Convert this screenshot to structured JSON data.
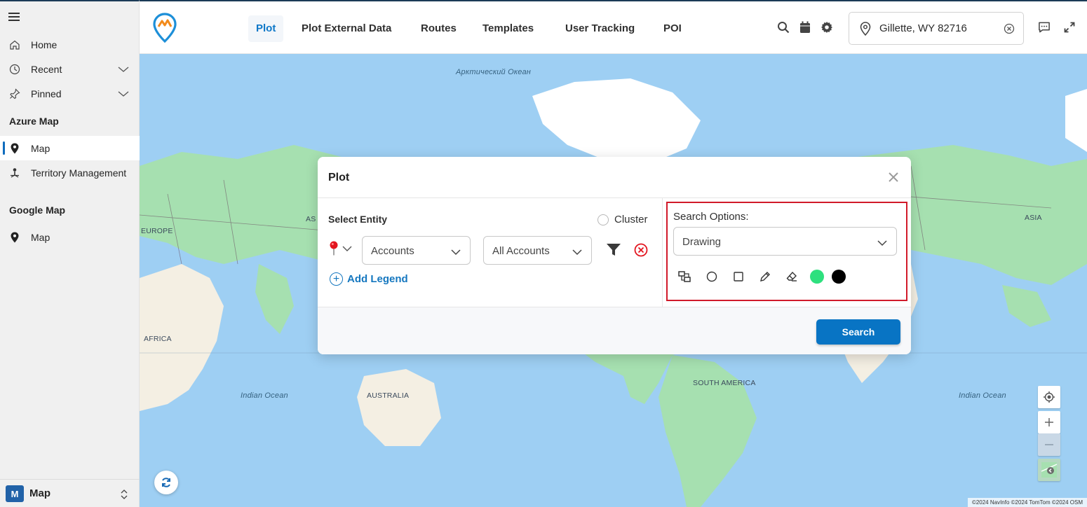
{
  "sidebar": {
    "items": [
      {
        "label": "Home",
        "icon": "home-icon"
      },
      {
        "label": "Recent",
        "icon": "clock-icon"
      },
      {
        "label": "Pinned",
        "icon": "pin-icon"
      }
    ],
    "sections": [
      {
        "title": "Azure Map",
        "items": [
          {
            "label": "Map",
            "icon": "map-marker-icon",
            "active": true
          },
          {
            "label": "Territory Management",
            "icon": "territory-icon"
          }
        ]
      },
      {
        "title": "Google Map",
        "items": [
          {
            "label": "Map",
            "icon": "map-marker-icon"
          }
        ]
      }
    ],
    "footer": {
      "badge": "M",
      "label": "Map"
    }
  },
  "topbar": {
    "tabs": [
      "Plot",
      "Plot External Data",
      "Routes",
      "Templates",
      "User Tracking",
      "POI"
    ],
    "active_tab": "Plot",
    "location": {
      "value": "Gillette, WY 82716"
    }
  },
  "map": {
    "labels": {
      "arctic": "Арктический Океан",
      "europe": "EUROPE",
      "asia_left": "AS",
      "asia_right": "ASIA",
      "africa": "AFRICA",
      "indian_left": "Indian Ocean",
      "indian_right": "Indian Ocean",
      "australia": "AUSTRALIA",
      "south_america": "SOUTH AMERICA"
    },
    "attribution": "©2024 NavInfo ©2024 TomTom ©2024 OSM"
  },
  "modal": {
    "title": "Plot",
    "select_entity_label": "Select Entity",
    "cluster_label": "Cluster",
    "entity_select": "Accounts",
    "view_select": "All Accounts",
    "add_legend_label": "Add Legend",
    "search_options_label": "Search Options:",
    "search_option_value": "Drawing",
    "search_button": "Search",
    "swatch_colors": [
      "#2ee07e",
      "#000000"
    ]
  },
  "colors": {
    "accent": "#0874c4",
    "active_tab": "#0f78c8",
    "highlight_border": "#d11a2a",
    "map_water": "#9ecff3",
    "map_land": "#a6e0b0"
  }
}
